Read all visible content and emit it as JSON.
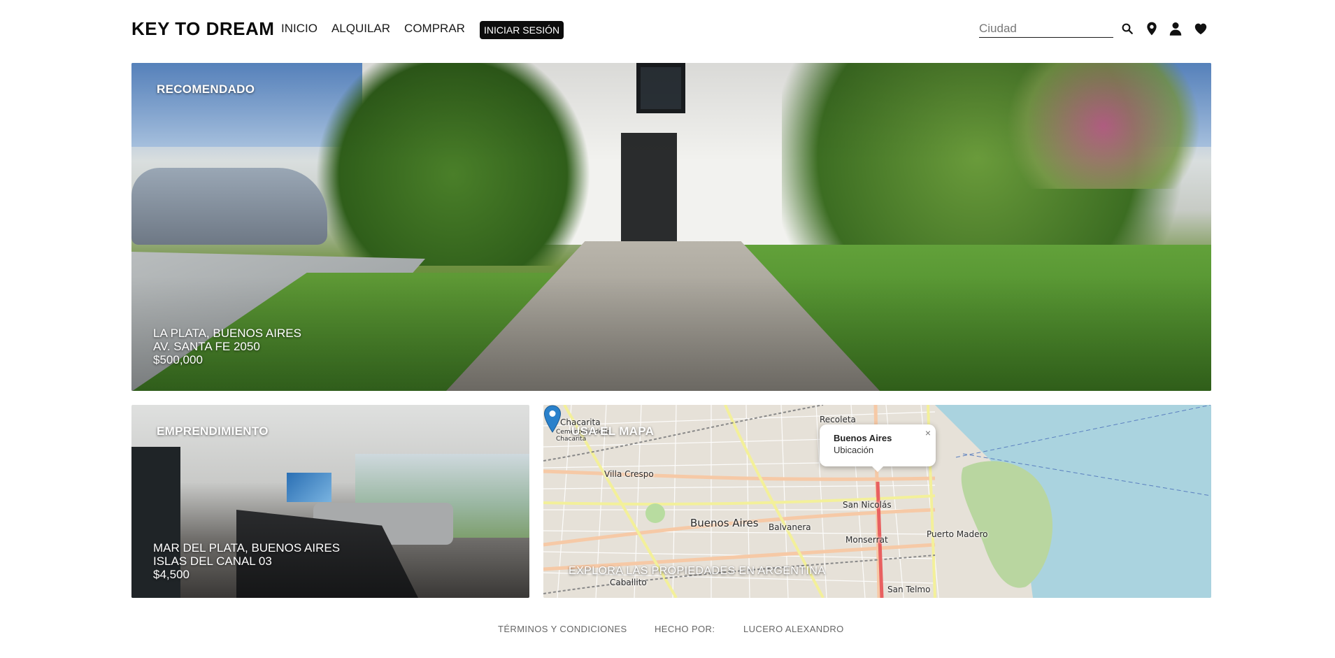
{
  "header": {
    "brand": "KEY TO DREAM",
    "nav": [
      {
        "label": "INICIO"
      },
      {
        "label": "ALQUILAR"
      },
      {
        "label": "COMPRAR"
      }
    ],
    "login_label": "INICIAR SESIÓN",
    "search": {
      "placeholder": "Ciudad",
      "value": ""
    },
    "icons": [
      "search-icon",
      "location-pin-icon",
      "user-icon",
      "heart-icon"
    ]
  },
  "hero": {
    "tag": "RECOMENDADO",
    "location": "LA PLATA, BUENOS AIRES",
    "address": "AV. SANTA FE 2050",
    "price": "$500,000"
  },
  "development": {
    "tag": "EMPRENDIMIENTO",
    "location": "MAR DEL PLATA, BUENOS AIRES",
    "address": "ISLAS DEL CANAL 03",
    "price": "$4,500"
  },
  "map": {
    "tag": "USA EL MAPA",
    "caption": "EXPLORA LAS PROPIEDADES EN ARGENTINA",
    "popup": {
      "title": "Buenos Aires",
      "subtitle": "Ubicación",
      "close": "×"
    },
    "labels": {
      "chacarita": "Chacarita",
      "cementerio": "Cementerio de la Chacarita",
      "recoleta": "Recoleta",
      "villa_crespo": "Villa Crespo",
      "buenos_aires": "Buenos Aires",
      "balvanera": "Balvanera",
      "san_nicolas": "San Nicolás",
      "monserrat": "Monserrat",
      "puerto_madero": "Puerto Madero",
      "caballito": "Caballito",
      "san_telmo": "San Telmo"
    },
    "colors": {
      "water": "#aad3df",
      "land": "#e8e3da",
      "road_main": "#f7c8a8",
      "road_yellow": "#f7f4a8",
      "park": "#c8e0b0",
      "pin": "#2a81cb"
    }
  },
  "footer": {
    "terms": "TÉRMINOS Y CONDICIONES",
    "made_by": "HECHO POR:",
    "author": "LUCERO ALEXANDRO"
  }
}
